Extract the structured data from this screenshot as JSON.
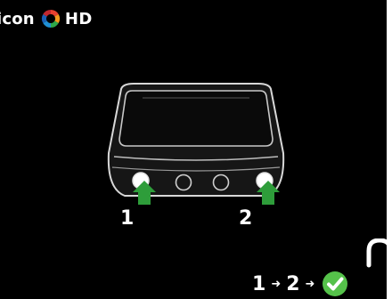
{
  "header": {
    "brand_word": "icon",
    "brand_suffix": "HD"
  },
  "instruction": {
    "button_1_number": "1",
    "button_2_number": "2",
    "sequence_step_1": "1",
    "sequence_step_2": "2",
    "arrow_glyph": "➜"
  },
  "colors": {
    "background": "#000000",
    "arrow_green": "#2e9d3a",
    "check_green": "#55c24a",
    "text": "#ffffff"
  },
  "icons": [
    "icon-logo",
    "device-illustration",
    "press-arrow-icon",
    "check-circle-icon",
    "unlock-icon"
  ]
}
